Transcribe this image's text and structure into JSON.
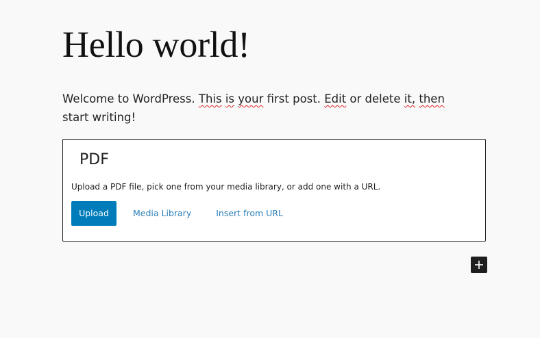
{
  "post": {
    "title": "Hello world!",
    "paragraph": {
      "t1": "Welcome to WordPress. ",
      "w_this": "This",
      "t2": " ",
      "w_is": "is",
      "t3": " ",
      "w_your": "your",
      "t4": " first post. ",
      "w_edit": "Edit",
      "t5": " or delete ",
      "w_it": "it,",
      "t6": " ",
      "w_then": "then",
      "t7": " start writing!"
    }
  },
  "pdf_block": {
    "title": "PDF",
    "instructions": "Upload a PDF file, pick one from your media library, or add one with a URL.",
    "upload_label": "Upload",
    "media_library_label": "Media Library",
    "insert_url_label": "Insert from URL"
  },
  "inserter": {
    "icon": "plus-icon"
  },
  "colors": {
    "background": "#f9f9f9",
    "primary_button": "#007cba",
    "link": "#2a7fb7",
    "block_border": "#1e1e1e",
    "spellcheck_underline": "#e02020"
  }
}
